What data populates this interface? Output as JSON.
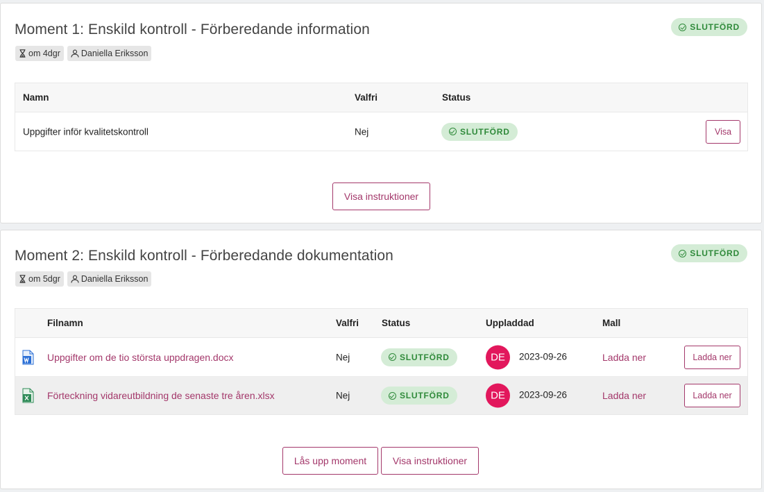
{
  "colors": {
    "accent": "#a3376a",
    "status_bg": "#d4ecd6",
    "status_text": "#2f8a3a",
    "avatar_bg": "#e2175c"
  },
  "moment1": {
    "title": "Moment 1: Enskild kontroll - Förberedande information",
    "status": "SLUTFÖRD",
    "due_chip": "om 4dgr",
    "user_chip": "Daniella Eriksson",
    "columns": {
      "name": "Namn",
      "optional": "Valfri",
      "status": "Status"
    },
    "rows": [
      {
        "name": "Uppgifter inför kvalitetskontroll",
        "optional": "Nej",
        "status": "SLUTFÖRD",
        "action": "Visa"
      }
    ],
    "instructions_button": "Visa instruktioner"
  },
  "moment2": {
    "title": "Moment 2: Enskild kontroll - Förberedande dokumentation",
    "status": "SLUTFÖRD",
    "due_chip": "om 5dgr",
    "user_chip": "Daniella Eriksson",
    "columns": {
      "filename": "Filnamn",
      "optional": "Valfri",
      "status": "Status",
      "uploaded": "Uppladdad",
      "template": "Mall"
    },
    "rows": [
      {
        "file_icon": "word-file-icon",
        "filename": "Uppgifter om de tio största uppdragen.docx",
        "optional": "Nej",
        "status": "SLUTFÖRD",
        "avatar": "DE",
        "uploaded": "2023-09-26",
        "template": "Ladda ner",
        "action": "Ladda ner"
      },
      {
        "file_icon": "excel-file-icon",
        "filename": "Förteckning vidareutbildning de senaste tre åren.xlsx",
        "optional": "Nej",
        "status": "SLUTFÖRD",
        "avatar": "DE",
        "uploaded": "2023-09-26",
        "template": "Ladda ner",
        "action": "Ladda ner"
      }
    ],
    "unlock_button": "Lås upp moment",
    "instructions_button": "Visa instruktioner"
  }
}
